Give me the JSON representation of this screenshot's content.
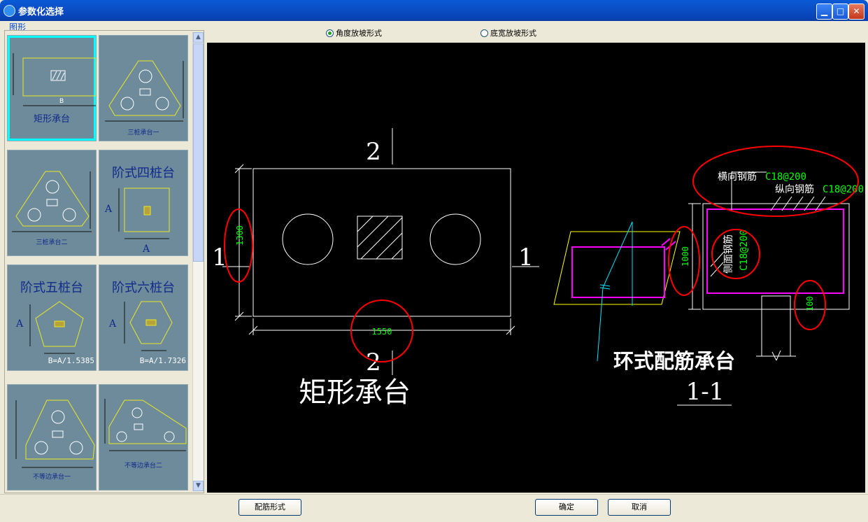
{
  "window": {
    "title": "参数化选择"
  },
  "group_label": "图形",
  "thumbnails": [
    {
      "label": "矩形承台",
      "selected": true
    },
    {
      "label": "三桩承台一"
    },
    {
      "label": "三桩承台二"
    },
    {
      "label": "阶式四桩台"
    },
    {
      "label": "阶式五桩台",
      "note": "B=A/1.5385"
    },
    {
      "label": "阶式六桩台",
      "note": "B=A/1.7326"
    },
    {
      "label": "不等边承台一"
    },
    {
      "label": "不等边承台二"
    }
  ],
  "thumb_dims": {
    "A": "A",
    "B": "B"
  },
  "radios": [
    {
      "label": "角度放坡形式",
      "checked": true
    },
    {
      "label": "底宽放坡形式",
      "checked": false
    }
  ],
  "drawing": {
    "section_mark_1": "1",
    "section_mark_2": "2",
    "dim_height": "1300",
    "dim_width": "1550",
    "plan_title": "矩形承台",
    "iso_title": "环式配筋承台",
    "section_title": "1-1",
    "dim_section_height": "1000",
    "dim_cover": "100",
    "rebar_transverse_label": "横向钢筋",
    "rebar_transverse_value": "C18@200",
    "rebar_longitudinal_label": "纵向钢筋",
    "rebar_longitudinal_value": "C18@200",
    "rebar_side_label": "侧面钢筋",
    "rebar_side_value": "C18@200"
  },
  "buttons": {
    "rebar_form": "配筋形式",
    "ok": "确定",
    "cancel": "取消"
  },
  "colors": {
    "title_bar": "#0b4fc7",
    "thumb_bg": "#6e8b9c",
    "selected_border": "#00ffff",
    "dim_text": "#00ff00",
    "highlight_circle": "#ff0000",
    "rebar_ring": "#ff00ff"
  }
}
